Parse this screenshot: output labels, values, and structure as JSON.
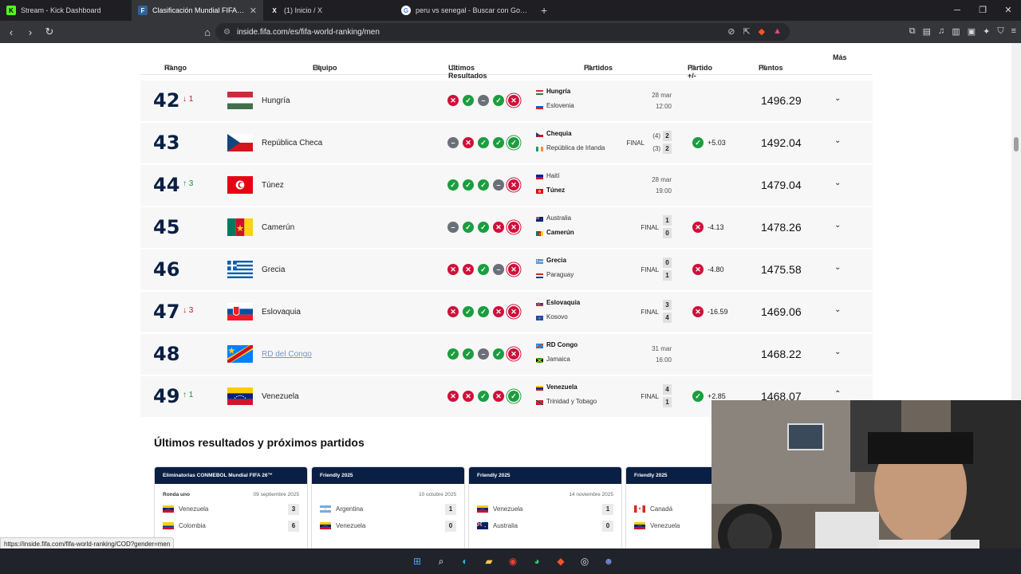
{
  "browser": {
    "tabs": [
      {
        "title": "Stream - Kick Dashboard",
        "icon": "kick-icon",
        "active": false
      },
      {
        "title": "Clasificación Mundial FIFA/Coca-Cola",
        "icon": "fifa-icon",
        "active": true
      },
      {
        "title": "(1) Inicio / X",
        "icon": "x-icon",
        "active": false
      },
      {
        "title": "peru vs senegal - Buscar con Google",
        "icon": "google-icon",
        "active": false
      }
    ],
    "url": "inside.fifa.com/es/fifa-world-ranking/men"
  },
  "table": {
    "headers": {
      "rank": "Rango",
      "team": "Equipo",
      "last": "Ultimos Resultados",
      "matches": "Partidos",
      "pm": "Partido +/-",
      "points": "Puntos",
      "more": "Más"
    },
    "rows": [
      {
        "rank": "42",
        "move": "1",
        "dir": "down",
        "team": "Hungría",
        "flag": "hungary",
        "results": [
          "l",
          "w",
          "d",
          "w",
          "l"
        ],
        "home": "Hungría",
        "home_flag": "hungary",
        "home_bold": true,
        "away": "Eslovenia",
        "away_flag": "slovenia",
        "away_bold": false,
        "status": "",
        "date": "28 mar",
        "time": "12:00",
        "score_home": "",
        "score_away": "",
        "pen_home": "",
        "pen_away": "",
        "pm": "",
        "pm_res": "",
        "points": "1496.29",
        "chev": "⌄"
      },
      {
        "rank": "43",
        "move": "",
        "dir": "",
        "team": "República Checa",
        "flag": "czech",
        "results": [
          "d",
          "l",
          "w",
          "w",
          "w"
        ],
        "home": "Chequia",
        "home_flag": "czech",
        "home_bold": true,
        "away": "República de Irlanda",
        "away_flag": "ireland",
        "away_bold": false,
        "status": "FINAL",
        "date": "",
        "time": "",
        "score_home": "2",
        "score_away": "2",
        "pen_home": "(4)",
        "pen_away": "(3)",
        "pm": "+5.03",
        "pm_res": "w",
        "points": "1492.04",
        "chev": "⌄"
      },
      {
        "rank": "44",
        "move": "3",
        "dir": "up",
        "team": "Túnez",
        "flag": "tunisia",
        "results": [
          "w",
          "w",
          "w",
          "d",
          "l"
        ],
        "home": "Haití",
        "home_flag": "haiti",
        "home_bold": false,
        "away": "Túnez",
        "away_flag": "tunisia",
        "away_bold": true,
        "status": "",
        "date": "28 mar",
        "time": "19:00",
        "score_home": "",
        "score_away": "",
        "pen_home": "",
        "pen_away": "",
        "pm": "",
        "pm_res": "",
        "points": "1479.04",
        "chev": "⌄"
      },
      {
        "rank": "45",
        "move": "",
        "dir": "",
        "team": "Camerún",
        "flag": "cameroon",
        "results": [
          "d",
          "w",
          "w",
          "l",
          "l"
        ],
        "home": "Australia",
        "home_flag": "australia",
        "home_bold": false,
        "away": "Camerún",
        "away_flag": "cameroon",
        "away_bold": true,
        "status": "FINAL",
        "date": "",
        "time": "",
        "score_home": "1",
        "score_away": "0",
        "pen_home": "",
        "pen_away": "",
        "pm": "-4.13",
        "pm_res": "l",
        "points": "1478.26",
        "chev": "⌄"
      },
      {
        "rank": "46",
        "move": "",
        "dir": "",
        "team": "Grecia",
        "flag": "greece",
        "results": [
          "l",
          "l",
          "w",
          "d",
          "l"
        ],
        "home": "Grecia",
        "home_flag": "greece",
        "home_bold": true,
        "away": "Paraguay",
        "away_flag": "paraguay",
        "away_bold": false,
        "status": "FINAL",
        "date": "",
        "time": "",
        "score_home": "0",
        "score_away": "1",
        "pen_home": "",
        "pen_away": "",
        "pm": "-4.80",
        "pm_res": "l",
        "points": "1475.58",
        "chev": "⌄"
      },
      {
        "rank": "47",
        "move": "3",
        "dir": "down",
        "team": "Eslovaquia",
        "flag": "slovakia",
        "results": [
          "l",
          "w",
          "w",
          "l",
          "l"
        ],
        "home": "Eslovaquia",
        "home_flag": "slovakia",
        "home_bold": true,
        "away": "Kosovo",
        "away_flag": "kosovo",
        "away_bold": false,
        "status": "FINAL",
        "date": "",
        "time": "",
        "score_home": "3",
        "score_away": "4",
        "pen_home": "",
        "pen_away": "",
        "pm": "-16.59",
        "pm_res": "l",
        "points": "1469.06",
        "chev": "⌄"
      },
      {
        "rank": "48",
        "move": "",
        "dir": "",
        "team": "RD del Congo",
        "flag": "drcongo",
        "link": true,
        "results": [
          "w",
          "w",
          "d",
          "w",
          "l"
        ],
        "home": "RD Congo",
        "home_flag": "drcongo",
        "home_bold": true,
        "away": "Jamaica",
        "away_flag": "jamaica",
        "away_bold": false,
        "status": "",
        "date": "31 mar",
        "time": "16:00",
        "score_home": "",
        "score_away": "",
        "pen_home": "",
        "pen_away": "",
        "pm": "",
        "pm_res": "",
        "points": "1468.22",
        "chev": "⌄"
      },
      {
        "rank": "49",
        "move": "1",
        "dir": "up",
        "team": "Venezuela",
        "flag": "venezuela",
        "results": [
          "l",
          "l",
          "w",
          "l",
          "w"
        ],
        "home": "Venezuela",
        "home_flag": "venezuela",
        "home_bold": true,
        "away": "Trinidad y Tobago",
        "away_flag": "trinidad",
        "away_bold": false,
        "status": "FINAL",
        "date": "",
        "time": "",
        "score_home": "4",
        "score_away": "1",
        "pen_home": "",
        "pen_away": "",
        "pm": "+2.85",
        "pm_res": "w",
        "points": "1468.07",
        "chev": "⌃"
      }
    ]
  },
  "section_title": "Últimos resultados y próximos partidos",
  "cards": [
    {
      "comp": "Eliminatorias CONMEBOL Mundial FIFA 26™",
      "round": "Ronda uno",
      "date": "09 septiembre 2025",
      "t1": "Venezuela",
      "f1": "venezuela",
      "s1": "3",
      "t2": "Colombia",
      "f2": "colombia",
      "s2": "6"
    },
    {
      "comp": "Friendly 2025",
      "round": "",
      "date": "10 octubre 2025",
      "t1": "Argentina",
      "f1": "argentina",
      "s1": "1",
      "t2": "Venezuela",
      "f2": "venezuela",
      "s2": "0"
    },
    {
      "comp": "Friendly 2025",
      "round": "",
      "date": "14 noviembre 2025",
      "t1": "Venezuela",
      "f1": "venezuela",
      "s1": "1",
      "t2": "Australia",
      "f2": "australia",
      "s2": "0"
    },
    {
      "comp": "Friendly 2025",
      "round": "",
      "date": "",
      "t1": "Canadá",
      "f1": "canada",
      "s1": "",
      "t2": "Venezuela",
      "f2": "venezuela",
      "s2": ""
    }
  ],
  "status_url": "https://inside.fifa.com/fifa-world-ranking/COD?gender=men",
  "colors": {
    "win": "#1a9e3f",
    "loss": "#d0103a",
    "draw": "#6b6f78",
    "navy": "#0a1f44"
  }
}
